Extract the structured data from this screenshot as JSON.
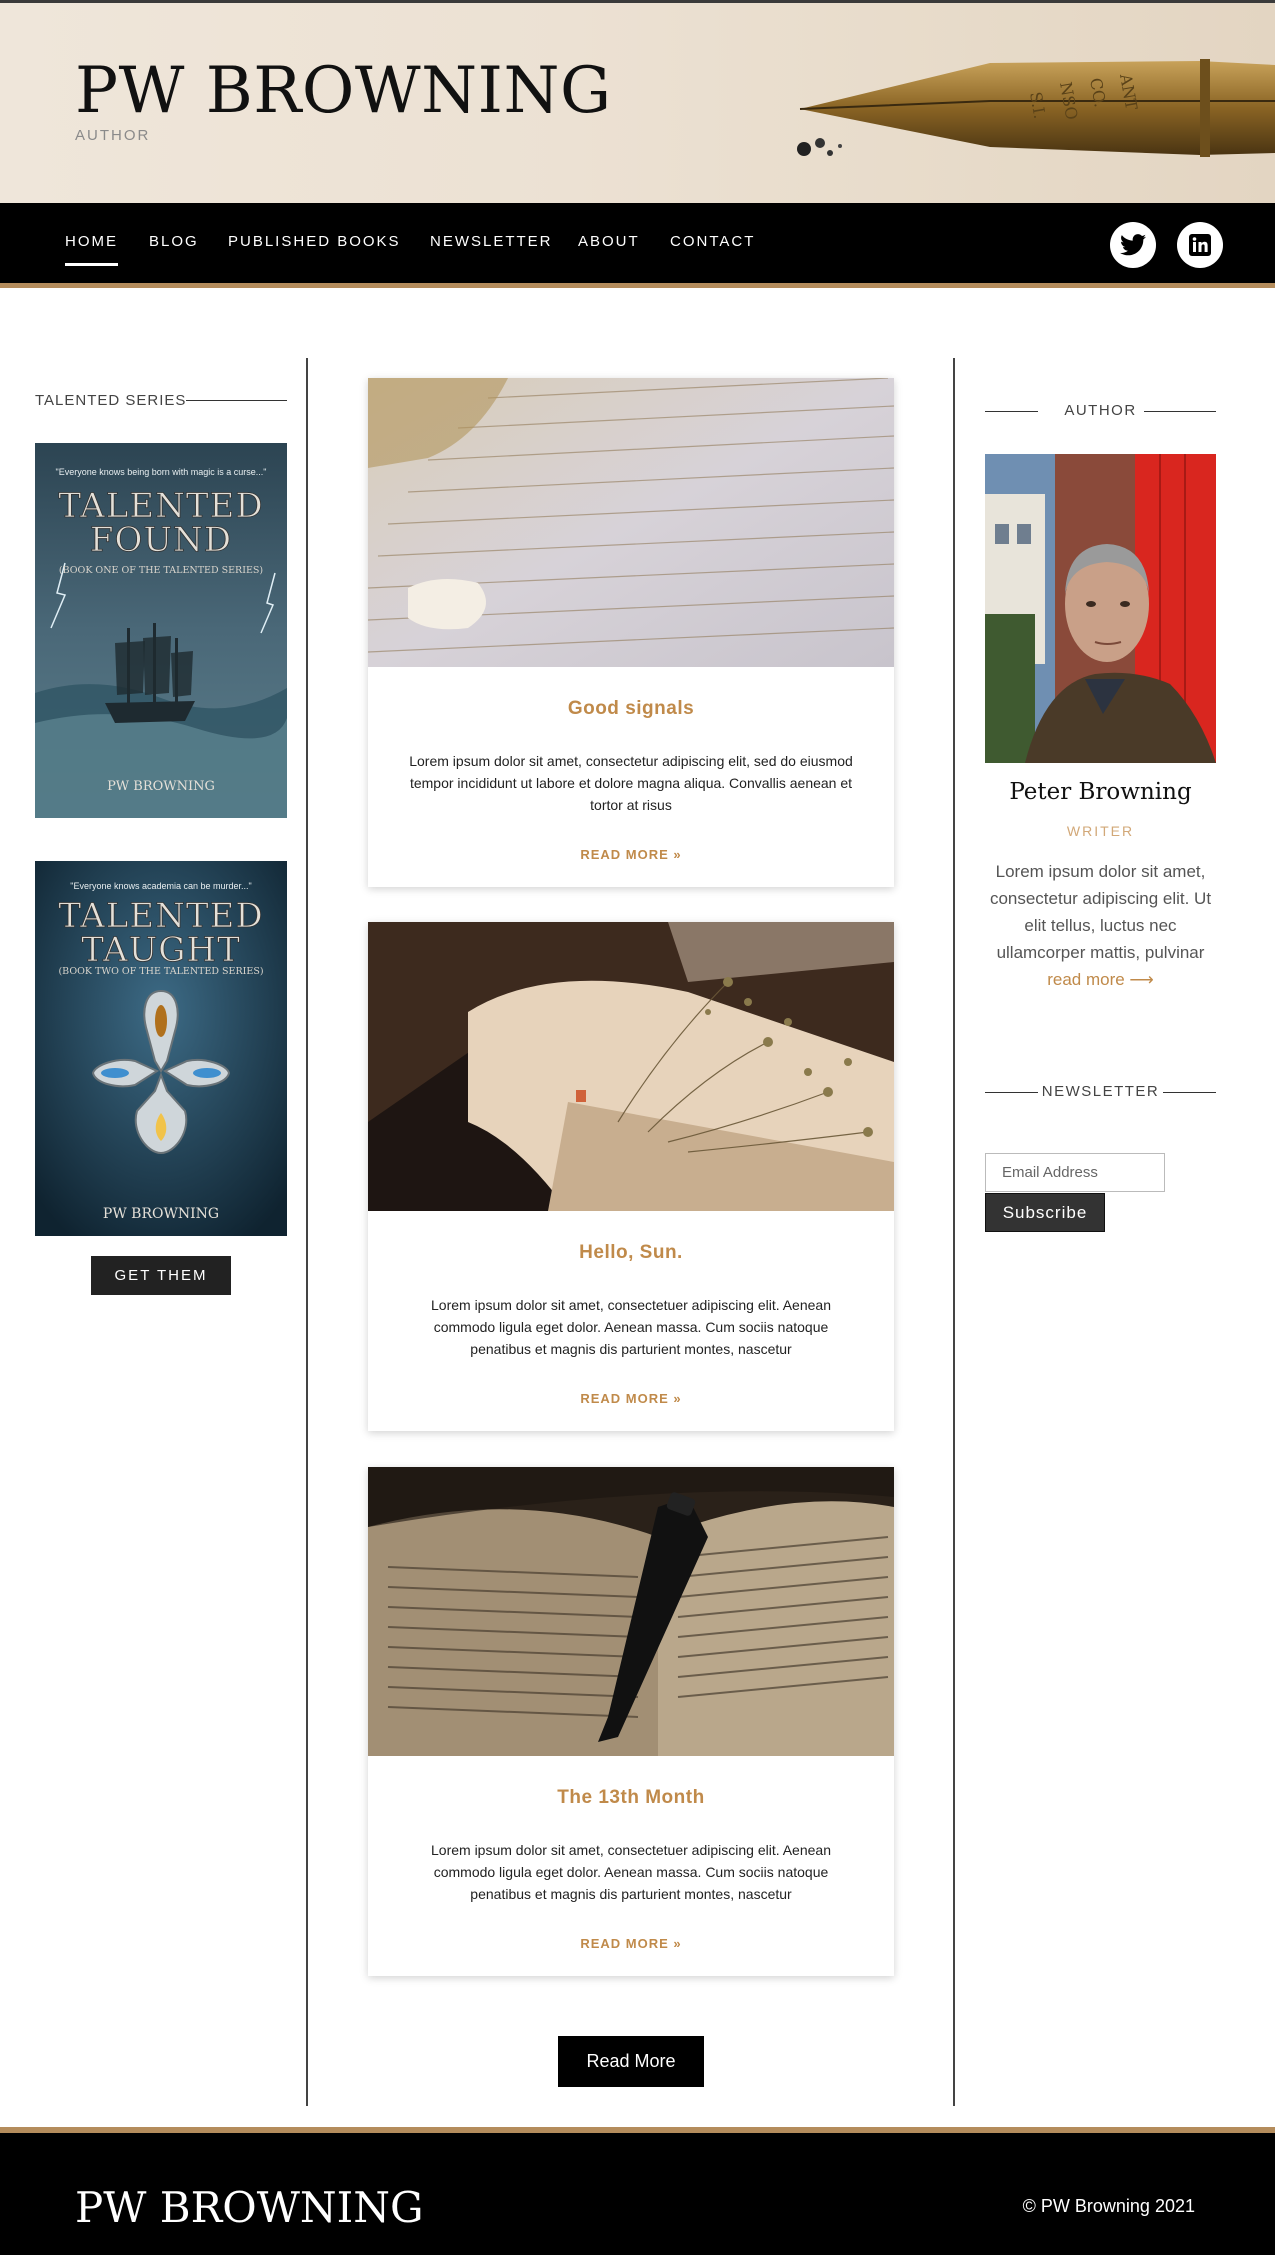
{
  "site": {
    "title": "PW BROWNING",
    "tagline": "AUTHOR"
  },
  "nav": {
    "items": [
      {
        "label": "HOME",
        "active": true
      },
      {
        "label": "BLOG"
      },
      {
        "label": "PUBLISHED BOOKS"
      },
      {
        "label": "NEWSLETTER"
      },
      {
        "label": "ABOUT"
      },
      {
        "label": "CONTACT"
      }
    ],
    "social": [
      {
        "icon": "twitter-icon"
      },
      {
        "icon": "linkedin-icon"
      }
    ]
  },
  "left_sidebar": {
    "heading": "TALENTED SERIES",
    "books": [
      {
        "tagline": "\"Everyone knows being born with magic is a curse...\"",
        "title_line1": "TALENTED",
        "title_line2": "FOUND",
        "subtitle": "(BOOK ONE OF THE TALENTED SERIES)",
        "author": "PW BROWNING"
      },
      {
        "tagline": "\"Everyone knows academia can be murder...\"",
        "title_line1": "TALENTED",
        "title_line2": "TAUGHT",
        "subtitle": "(BOOK TWO OF THE TALENTED SERIES)",
        "author": "PW BROWNING"
      }
    ],
    "button_label": "GET THEM"
  },
  "posts": [
    {
      "title": "Good signals",
      "excerpt": "Lorem ipsum dolor sit amet, consectetur adipiscing elit, sed do eiusmod tempor incididunt ut labore et dolore magna aliqua. Convallis aenean et tortor at risus",
      "more": "READ MORE »"
    },
    {
      "title": "Hello, Sun.",
      "excerpt": "Lorem ipsum dolor sit amet, consectetuer adipiscing elit. Aenean commodo ligula eget dolor. Aenean massa. Cum sociis natoque penatibus et magnis dis parturient montes, nascetur",
      "more": "READ MORE »"
    },
    {
      "title": "The 13th Month",
      "excerpt": "Lorem ipsum dolor sit amet, consectetuer adipiscing elit. Aenean commodo ligula eget dolor. Aenean massa. Cum sociis natoque penatibus et magnis dis parturient montes, nascetur",
      "more": "READ MORE »"
    }
  ],
  "read_more_button": "Read More",
  "right_sidebar": {
    "author_heading": "AUTHOR",
    "author_name": "Peter Browning",
    "author_role": "WRITER",
    "author_bio": "Lorem ipsum dolor sit amet, consectetur adipiscing elit. Ut elit tellus, luctus nec ullamcorper mattis, pulvinar",
    "author_bio_link": "read more ⟶",
    "newsletter_heading": "NEWSLETTER",
    "email_placeholder": "Email Address",
    "subscribe_label": "Subscribe"
  },
  "footer": {
    "title": "PW BROWNING",
    "copyright": "© PW Browning 2021"
  },
  "colors": {
    "accent": "#c08a4a",
    "gold_bar": "#b48c5c",
    "nav_bg": "#000000"
  }
}
